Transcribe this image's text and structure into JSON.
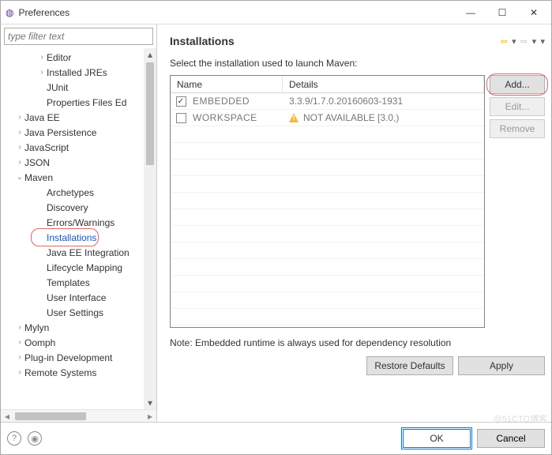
{
  "window": {
    "title": "Preferences"
  },
  "filter": {
    "placeholder": "type filter text"
  },
  "tree": [
    {
      "label": "Editor",
      "level": 2,
      "arrow": ">"
    },
    {
      "label": "Installed JREs",
      "level": 2,
      "arrow": ">"
    },
    {
      "label": "JUnit",
      "level": 2,
      "arrow": ""
    },
    {
      "label": "Properties Files Ed",
      "level": 2,
      "arrow": ""
    },
    {
      "label": "Java EE",
      "level": 1,
      "arrow": ">"
    },
    {
      "label": "Java Persistence",
      "level": 1,
      "arrow": ">"
    },
    {
      "label": "JavaScript",
      "level": 1,
      "arrow": ">"
    },
    {
      "label": "JSON",
      "level": 1,
      "arrow": ">"
    },
    {
      "label": "Maven",
      "level": 1,
      "arrow": "v"
    },
    {
      "label": "Archetypes",
      "level": 2,
      "arrow": ""
    },
    {
      "label": "Discovery",
      "level": 2,
      "arrow": ""
    },
    {
      "label": "Errors/Warnings",
      "level": 2,
      "arrow": ""
    },
    {
      "label": "Installations",
      "level": 2,
      "arrow": "",
      "selected": true,
      "highlight": true
    },
    {
      "label": "Java EE Integration",
      "level": 2,
      "arrow": ""
    },
    {
      "label": "Lifecycle Mapping",
      "level": 2,
      "arrow": ""
    },
    {
      "label": "Templates",
      "level": 2,
      "arrow": ""
    },
    {
      "label": "User Interface",
      "level": 2,
      "arrow": ""
    },
    {
      "label": "User Settings",
      "level": 2,
      "arrow": ""
    },
    {
      "label": "Mylyn",
      "level": 1,
      "arrow": ">"
    },
    {
      "label": "Oomph",
      "level": 1,
      "arrow": ">"
    },
    {
      "label": "Plug-in Development",
      "level": 1,
      "arrow": ">"
    },
    {
      "label": "Remote Systems",
      "level": 1,
      "arrow": ">"
    }
  ],
  "page": {
    "title": "Installations",
    "desc": "Select the installation used to launch Maven:",
    "note": "Note: Embedded runtime is always used for dependency resolution",
    "columns": {
      "name": "Name",
      "details": "Details"
    },
    "rows": [
      {
        "checked": true,
        "name": "EMBEDDED",
        "details": "3.3.9/1.7.0.20160603-1931",
        "warn": false
      },
      {
        "checked": false,
        "name": "WORKSPACE",
        "details": "NOT AVAILABLE [3.0,)",
        "warn": true
      }
    ],
    "buttons": {
      "add": "Add...",
      "edit": "Edit...",
      "remove": "Remove",
      "restore": "Restore Defaults",
      "apply": "Apply"
    }
  },
  "footer": {
    "ok": "OK",
    "cancel": "Cancel"
  },
  "watermark": "@51CTO博客"
}
